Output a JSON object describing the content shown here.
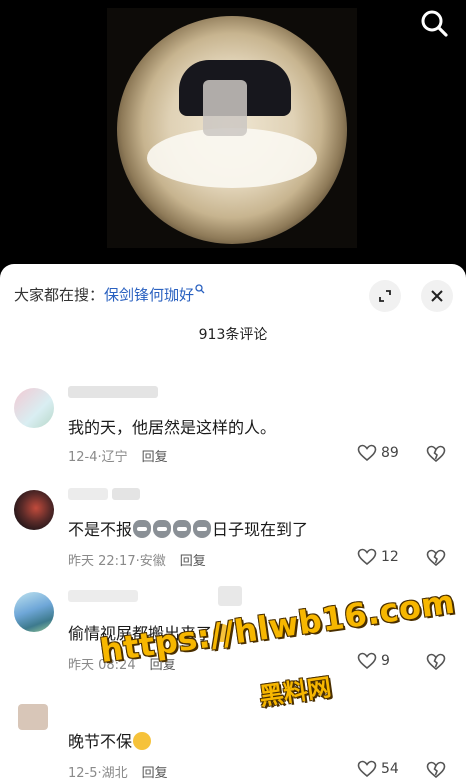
{
  "search_bar": {
    "prefix": "大家都在搜：",
    "term": "保剑锋何珈好"
  },
  "comment_count": "913条评论",
  "comments": [
    {
      "text": "我的天，他居然是这样的人。",
      "date": "12-4",
      "location": "辽宁",
      "reply": "回复",
      "likes": "89"
    },
    {
      "text_before": "不是不报",
      "text_after": "日子现在到了",
      "date": "昨天 22:17",
      "location": "安徽",
      "reply": "回复",
      "likes": "12"
    },
    {
      "text": "偷情视屏都搬出来了",
      "date": "昨天 08:24",
      "location": "",
      "reply": "回复",
      "likes": "9"
    },
    {
      "text": "晚节不保",
      "date": "12-5",
      "location": "湖北",
      "reply": "回复",
      "likes": "54"
    }
  ],
  "watermark": {
    "url": "https://hlwb16.com",
    "name": "黑料网"
  },
  "icons": {
    "search": "search-icon",
    "expand": "expand-icon",
    "close": "close-icon",
    "like": "heart-icon",
    "dislike": "broken-heart-icon"
  },
  "colors": {
    "link": "#2a61c0",
    "watermark": "#f7b700"
  }
}
